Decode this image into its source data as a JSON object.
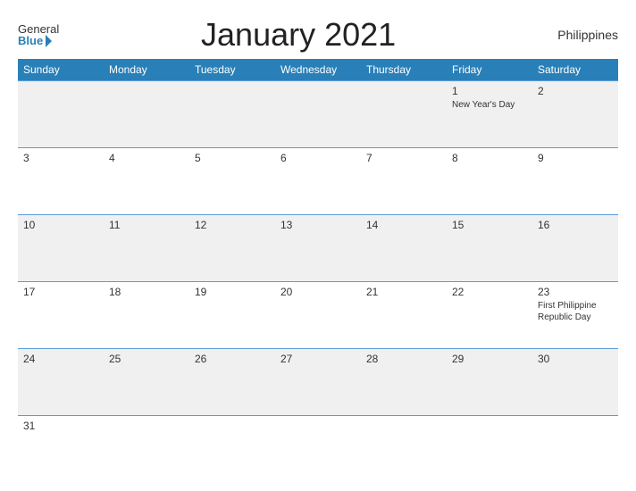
{
  "logo": {
    "general": "General",
    "blue": "Blue"
  },
  "header": {
    "title": "January 2021",
    "country": "Philippines"
  },
  "weekdays": [
    "Sunday",
    "Monday",
    "Tuesday",
    "Wednesday",
    "Thursday",
    "Friday",
    "Saturday"
  ],
  "weeks": [
    [
      {
        "day": "",
        "holiday": ""
      },
      {
        "day": "",
        "holiday": ""
      },
      {
        "day": "",
        "holiday": ""
      },
      {
        "day": "",
        "holiday": ""
      },
      {
        "day": "",
        "holiday": ""
      },
      {
        "day": "1",
        "holiday": "New Year's Day"
      },
      {
        "day": "2",
        "holiday": ""
      }
    ],
    [
      {
        "day": "3",
        "holiday": ""
      },
      {
        "day": "4",
        "holiday": ""
      },
      {
        "day": "5",
        "holiday": ""
      },
      {
        "day": "6",
        "holiday": ""
      },
      {
        "day": "7",
        "holiday": ""
      },
      {
        "day": "8",
        "holiday": ""
      },
      {
        "day": "9",
        "holiday": ""
      }
    ],
    [
      {
        "day": "10",
        "holiday": ""
      },
      {
        "day": "11",
        "holiday": ""
      },
      {
        "day": "12",
        "holiday": ""
      },
      {
        "day": "13",
        "holiday": ""
      },
      {
        "day": "14",
        "holiday": ""
      },
      {
        "day": "15",
        "holiday": ""
      },
      {
        "day": "16",
        "holiday": ""
      }
    ],
    [
      {
        "day": "17",
        "holiday": ""
      },
      {
        "day": "18",
        "holiday": ""
      },
      {
        "day": "19",
        "holiday": ""
      },
      {
        "day": "20",
        "holiday": ""
      },
      {
        "day": "21",
        "holiday": ""
      },
      {
        "day": "22",
        "holiday": ""
      },
      {
        "day": "23",
        "holiday": "First Philippine Republic Day"
      }
    ],
    [
      {
        "day": "24",
        "holiday": ""
      },
      {
        "day": "25",
        "holiday": ""
      },
      {
        "day": "26",
        "holiday": ""
      },
      {
        "day": "27",
        "holiday": ""
      },
      {
        "day": "28",
        "holiday": ""
      },
      {
        "day": "29",
        "holiday": ""
      },
      {
        "day": "30",
        "holiday": ""
      }
    ],
    [
      {
        "day": "31",
        "holiday": ""
      },
      {
        "day": "",
        "holiday": ""
      },
      {
        "day": "",
        "holiday": ""
      },
      {
        "day": "",
        "holiday": ""
      },
      {
        "day": "",
        "holiday": ""
      },
      {
        "day": "",
        "holiday": ""
      },
      {
        "day": "",
        "holiday": ""
      }
    ]
  ]
}
